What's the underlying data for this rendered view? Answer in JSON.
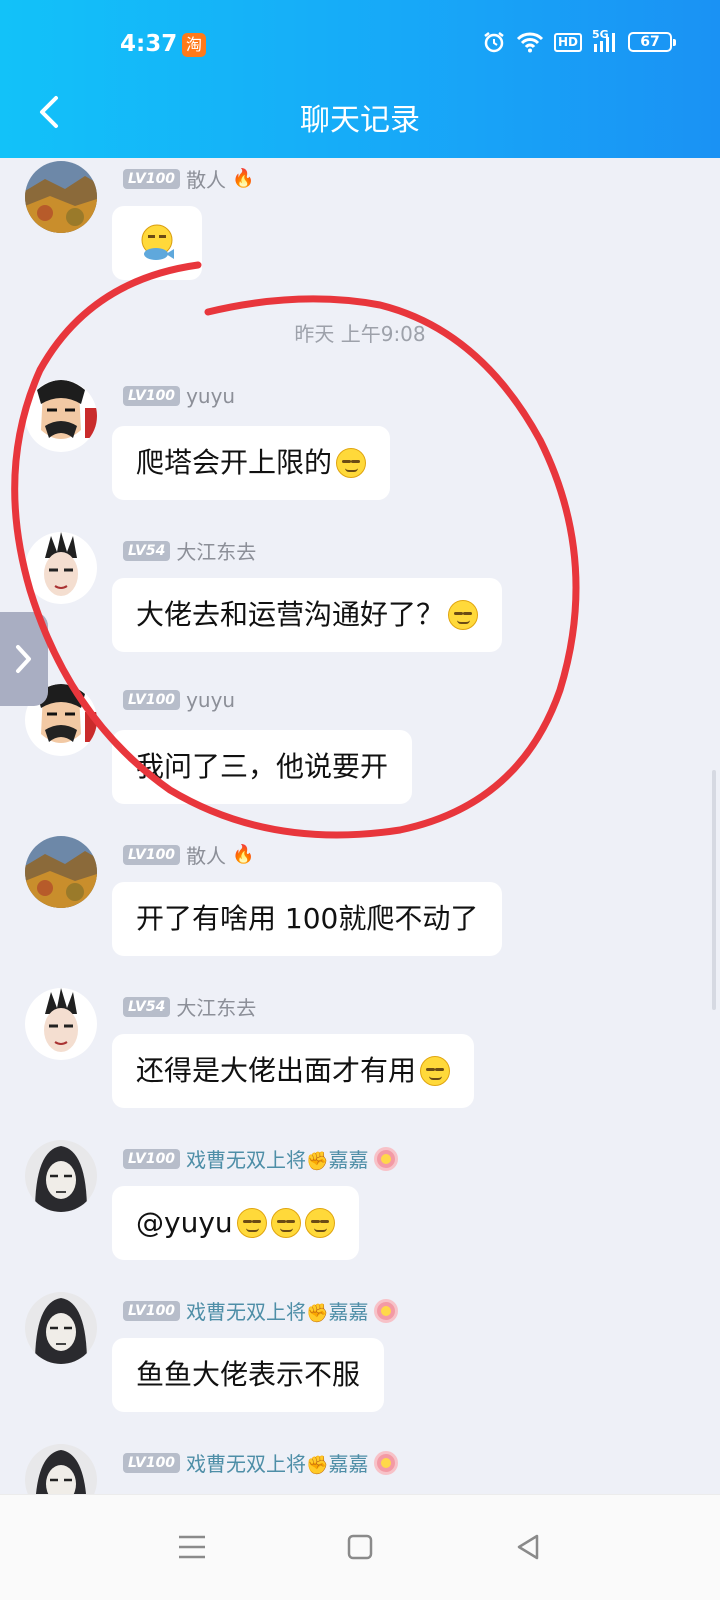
{
  "status_bar": {
    "time": "4:37",
    "taobao": "淘",
    "hd": "HD",
    "network": "5G",
    "battery": "67"
  },
  "header": {
    "title": "聊天记录"
  },
  "messages": [
    {
      "level": "LV100",
      "name": "散人",
      "text": ""
    },
    {
      "timestamp": "昨天 上午9:08"
    },
    {
      "level": "LV100",
      "name": "yuyu",
      "text": "爬塔会开上限的"
    },
    {
      "level": "LV54",
      "name": "大江东去",
      "text": "大佬去和运营沟通好了？"
    },
    {
      "level": "LV100",
      "name": "yuyu",
      "text": "我问了三，他说要开"
    },
    {
      "level": "LV100",
      "name": "散人",
      "text": "开了有啥用 100就爬不动了"
    },
    {
      "level": "LV54",
      "name": "大江东去",
      "text": "还得是大佬出面才有用"
    },
    {
      "level": "LV100",
      "name": "戏曹无双上将",
      "name_suffix": "嘉嘉",
      "text": "@yuyu "
    },
    {
      "level": "LV100",
      "name": "戏曹无双上将",
      "name_suffix": "嘉嘉",
      "text": "鱼鱼大佬表示不服"
    },
    {
      "level": "LV100",
      "name": "戏曹无双上将",
      "name_suffix": "嘉嘉",
      "text": ""
    }
  ],
  "colors": {
    "header_start": "#12c2f9",
    "header_end": "#1a92f4",
    "annotation": "#e8363c"
  }
}
